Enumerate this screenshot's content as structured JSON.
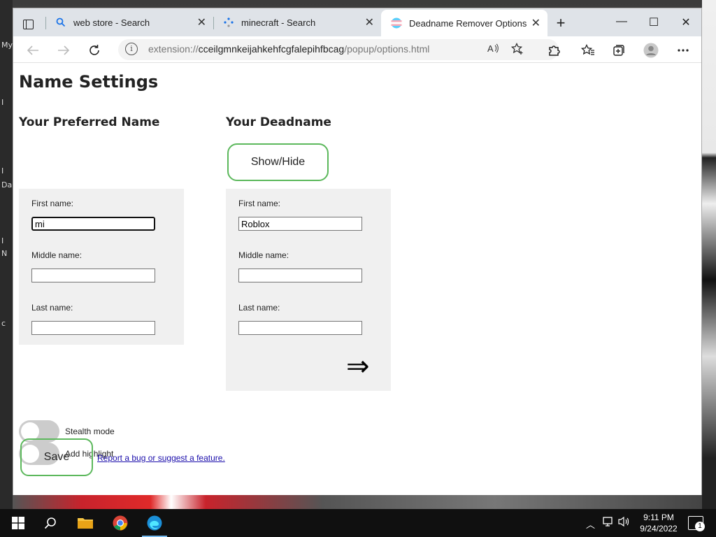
{
  "desktop": {
    "left_labels": [
      "My",
      "I",
      "I",
      "Da",
      "I",
      "N",
      "c"
    ]
  },
  "browser": {
    "tabs": [
      {
        "title": "web store - Search",
        "icon": "search-icon",
        "active": false
      },
      {
        "title": "minecraft - Search",
        "icon": "loading-icon",
        "active": false
      },
      {
        "title": "Deadname Remover Options",
        "icon": "extension-flag-icon",
        "active": true
      }
    ],
    "new_tab_symbol": "+",
    "window_controls": {
      "minimize": "—",
      "maximize": "☐",
      "close": "✕"
    },
    "toolbar": {
      "url_scheme": "extension://",
      "url_host": "cceilgmnkeijahkehfcgfalepihfbcag",
      "url_path": "/popup/options.html"
    }
  },
  "page": {
    "title": "Name Settings",
    "preferred": {
      "heading": "Your Preferred Name",
      "first_label": "First name:",
      "first_value": "mi",
      "middle_label": "Middle name:",
      "middle_value": "",
      "last_label": "Last name:",
      "last_value": ""
    },
    "deadname": {
      "heading": "Your Deadname",
      "show_hide_label": "Show/Hide",
      "first_label": "First name:",
      "first_value": "Roblox",
      "middle_label": "Middle name:",
      "middle_value": "",
      "last_label": "Last name:",
      "last_value": "",
      "arrow": "⇒"
    },
    "options": {
      "stealth_label": "Stealth mode",
      "highlight_label": "Add highlight"
    },
    "save_label": "Save",
    "report_link": "Report a bug or suggest a feature."
  },
  "taskbar": {
    "time": "9:11 PM",
    "date": "9/24/2022",
    "notification_count": "1"
  }
}
